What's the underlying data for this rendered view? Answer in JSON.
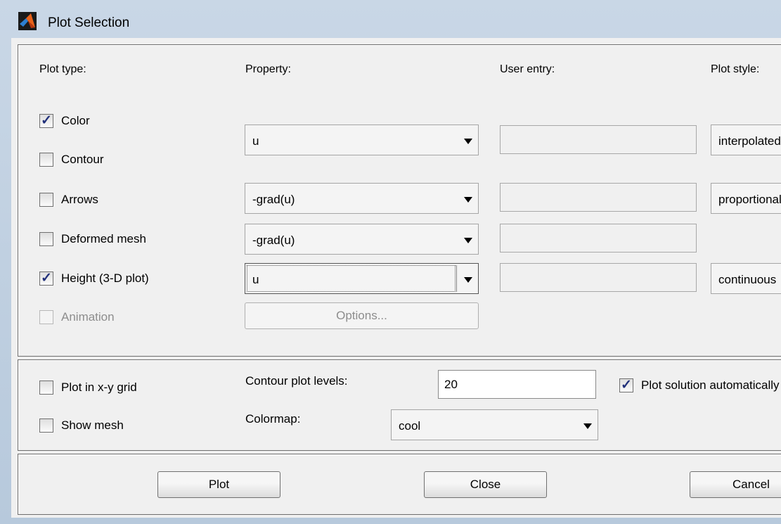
{
  "window": {
    "title": "Plot Selection"
  },
  "headers": {
    "plot_type": "Plot type:",
    "property": "Property:",
    "user_entry": "User entry:",
    "plot_style": "Plot style:"
  },
  "rows": {
    "color": {
      "label": "Color",
      "checked": true,
      "property": "u",
      "style": "interpolated"
    },
    "contour": {
      "label": "Contour",
      "checked": false
    },
    "arrows": {
      "label": "Arrows",
      "checked": false,
      "property": "-grad(u)",
      "style": "proportional"
    },
    "deformed": {
      "label": "Deformed mesh",
      "checked": false,
      "property": "-grad(u)"
    },
    "height": {
      "label": "Height (3-D plot)",
      "checked": true,
      "property": "u",
      "style": "continuous"
    },
    "animation": {
      "label": "Animation",
      "checked": false,
      "disabled": true,
      "options_label": "Options..."
    }
  },
  "options": {
    "grid": {
      "label": "Plot in x-y grid",
      "checked": false
    },
    "mesh": {
      "label": "Show mesh",
      "checked": false
    },
    "levels_label": "Contour plot levels:",
    "levels_value": "20",
    "colormap_label": "Colormap:",
    "colormap_value": "cool",
    "auto": {
      "label": "Plot solution automatically",
      "checked": true
    }
  },
  "buttons": {
    "plot": "Plot",
    "close": "Close",
    "cancel": "Cancel"
  }
}
